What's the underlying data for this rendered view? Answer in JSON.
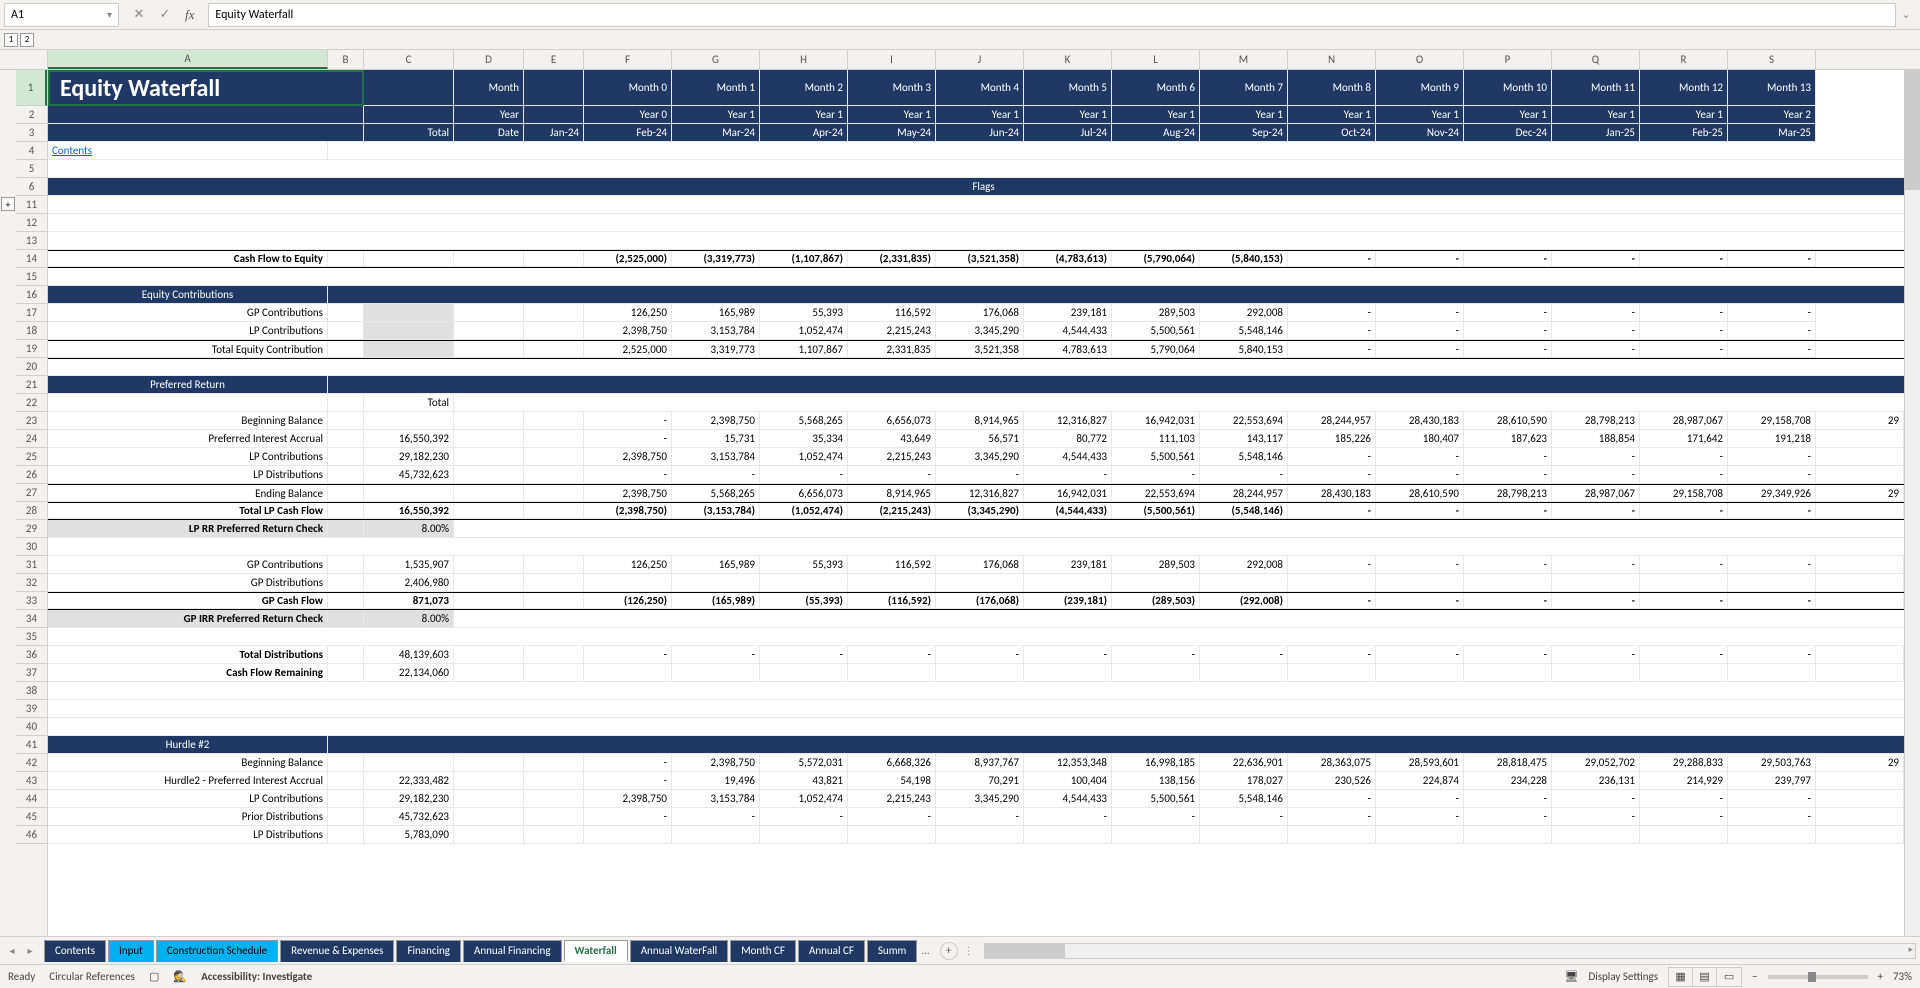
{
  "nameBox": "A1",
  "formula": "Equity Waterfall",
  "outline": [
    "1",
    "2"
  ],
  "columns": [
    "A",
    "B",
    "C",
    "D",
    "E",
    "F",
    "G",
    "H",
    "I",
    "J",
    "K",
    "L",
    "M",
    "N",
    "O",
    "P",
    "Q",
    "R",
    "S"
  ],
  "rowNumbers": [
    "1",
    "2",
    "3",
    "4",
    "5",
    "6",
    "11",
    "12",
    "13",
    "14",
    "15",
    "16",
    "17",
    "18",
    "19",
    "20",
    "21",
    "22",
    "23",
    "24",
    "25",
    "26",
    "27",
    "28",
    "29",
    "30",
    "31",
    "32",
    "33",
    "34",
    "35",
    "36",
    "37",
    "38",
    "39",
    "40",
    "41",
    "42",
    "43",
    "44",
    "45",
    "46"
  ],
  "title": "Equity Waterfall",
  "headerRows": {
    "month": [
      "Month",
      "",
      "Month 0",
      "Month 1",
      "Month 2",
      "Month 3",
      "Month 4",
      "Month 5",
      "Month 6",
      "Month 7",
      "Month 8",
      "Month 9",
      "Month 10",
      "Month 11",
      "Month 12",
      "Month 13"
    ],
    "year": [
      "Year",
      "",
      "Year 0",
      "Year 1",
      "Year 1",
      "Year 1",
      "Year 1",
      "Year 1",
      "Year 1",
      "Year 1",
      "Year 1",
      "Year 1",
      "Year 1",
      "Year 1",
      "Year 1",
      "Year 2"
    ],
    "date": [
      "Date",
      "Jan-24",
      "Feb-24",
      "Mar-24",
      "Apr-24",
      "May-24",
      "Jun-24",
      "Jul-24",
      "Aug-24",
      "Sep-24",
      "Oct-24",
      "Nov-24",
      "Dec-24",
      "Jan-25",
      "Feb-25",
      "Mar-25"
    ]
  },
  "labels": {
    "total": "Total",
    "contents": "Contents",
    "flags": "Flags",
    "cashFlowToEquity": "Cash Flow to Equity",
    "equityContributions": "Equity Contributions",
    "gpContributions": "GP Contributions",
    "lpContributions": "LP Contributions",
    "totalEquityContribution": "Total Equity Contribution",
    "preferredReturn": "Preferred Return",
    "beginningBalance": "Beginning Balance",
    "preferredInterestAccrual": "Preferred Interest Accrual",
    "lpDistributions": "LP Distributions",
    "endingBalance": "Ending Balance",
    "totalLpCashFlow": "Total LP Cash Flow",
    "lpRrCheck": "LP RR Preferred Return Check",
    "gpDistributions": "GP Distributions",
    "gpCashFlow": "GP Cash Flow",
    "gpIrrCheck": "GP IRR Preferred Return Check",
    "totalDistributions": "Total Distributions",
    "cashFlowRemaining": "Cash Flow Remaining",
    "hurdle2": "Hurdle #2",
    "hurdle2Accrual": "Hurdle2 - Preferred Interest Accrual",
    "priorDistributions": "Prior Distributions"
  },
  "rows": {
    "cashFlowToEquity": [
      "",
      "",
      "(2,525,000)",
      "(3,319,773)",
      "(1,107,867)",
      "(2,331,835)",
      "(3,521,358)",
      "(4,783,613)",
      "(5,790,064)",
      "(5,840,153)",
      "-",
      "-",
      "-",
      "-",
      "-",
      "-"
    ],
    "gpContributions": [
      "",
      "",
      "126,250",
      "165,989",
      "55,393",
      "116,592",
      "176,068",
      "239,181",
      "289,503",
      "292,008",
      "-",
      "-",
      "-",
      "-",
      "-",
      "-"
    ],
    "lpContributions": [
      "",
      "",
      "2,398,750",
      "3,153,784",
      "1,052,474",
      "2,215,243",
      "3,345,290",
      "4,544,433",
      "5,500,561",
      "5,548,146",
      "-",
      "-",
      "-",
      "-",
      "-",
      "-"
    ],
    "totalEquityContribution": [
      "",
      "",
      "2,525,000",
      "3,319,773",
      "1,107,867",
      "2,331,835",
      "3,521,358",
      "4,783,613",
      "5,790,064",
      "5,840,153",
      "-",
      "-",
      "-",
      "-",
      "-",
      "-"
    ],
    "prTotal": "Total",
    "beginningBalance": [
      "",
      "",
      "-",
      "2,398,750",
      "5,568,265",
      "6,656,073",
      "8,914,965",
      "12,316,827",
      "16,942,031",
      "22,553,694",
      "28,244,957",
      "28,430,183",
      "28,610,590",
      "28,798,213",
      "28,987,067",
      "29,158,708",
      "29"
    ],
    "preferredInterestAccrual": [
      "16,550,392",
      "",
      "-",
      "15,731",
      "35,334",
      "43,649",
      "56,571",
      "80,772",
      "111,103",
      "143,117",
      "185,226",
      "180,407",
      "187,623",
      "188,854",
      "171,642",
      "191,218",
      ""
    ],
    "lpContributions2": [
      "29,182,230",
      "",
      "2,398,750",
      "3,153,784",
      "1,052,474",
      "2,215,243",
      "3,345,290",
      "4,544,433",
      "5,500,561",
      "5,548,146",
      "-",
      "-",
      "-",
      "-",
      "-",
      "-",
      ""
    ],
    "lpDistributions": [
      "45,732,623",
      "",
      "-",
      "-",
      "-",
      "-",
      "-",
      "-",
      "-",
      "-",
      "-",
      "-",
      "-",
      "-",
      "-",
      "-",
      ""
    ],
    "endingBalance": [
      "",
      "",
      "2,398,750",
      "5,568,265",
      "6,656,073",
      "8,914,965",
      "12,316,827",
      "16,942,031",
      "22,553,694",
      "28,244,957",
      "28,430,183",
      "28,610,590",
      "28,798,213",
      "28,987,067",
      "29,158,708",
      "29,349,926",
      "29"
    ],
    "totalLpCashFlow": [
      "16,550,392",
      "",
      "(2,398,750)",
      "(3,153,784)",
      "(1,052,474)",
      "(2,215,243)",
      "(3,345,290)",
      "(4,544,433)",
      "(5,500,561)",
      "(5,548,146)",
      "-",
      "-",
      "-",
      "-",
      "-",
      "-",
      ""
    ],
    "lpRrCheck": "8.00%",
    "gpContributions2": [
      "1,535,907",
      "",
      "126,250",
      "165,989",
      "55,393",
      "116,592",
      "176,068",
      "239,181",
      "289,503",
      "292,008",
      "-",
      "-",
      "-",
      "-",
      "-",
      "-",
      ""
    ],
    "gpDistributions": [
      "2,406,980",
      "",
      "",
      "",
      "",
      "",
      "",
      "",
      "",
      "",
      "",
      "",
      "",
      "",
      "",
      "",
      ""
    ],
    "gpCashFlow": [
      "871,073",
      "",
      "(126,250)",
      "(165,989)",
      "(55,393)",
      "(116,592)",
      "(176,068)",
      "(239,181)",
      "(289,503)",
      "(292,008)",
      "-",
      "-",
      "-",
      "-",
      "-",
      "-",
      ""
    ],
    "gpIrrCheck": "8.00%",
    "totalDistributions": [
      "48,139,603",
      "",
      "-",
      "-",
      "-",
      "-",
      "-",
      "-",
      "-",
      "-",
      "-",
      "-",
      "-",
      "-",
      "-",
      "-",
      ""
    ],
    "cashFlowRemaining": [
      "22,134,060",
      "",
      "",
      "",
      "",
      "",
      "",
      "",
      "",
      "",
      "",
      "",
      "",
      "",
      "",
      "",
      ""
    ],
    "h2BeginningBalance": [
      "",
      "",
      "-",
      "2,398,750",
      "5,572,031",
      "6,668,326",
      "8,937,767",
      "12,353,348",
      "16,998,185",
      "22,636,901",
      "28,363,075",
      "28,593,601",
      "28,818,475",
      "29,052,702",
      "29,288,833",
      "29,503,763",
      "29"
    ],
    "h2Accrual": [
      "22,333,482",
      "",
      "-",
      "19,496",
      "43,821",
      "54,198",
      "70,291",
      "100,404",
      "138,156",
      "178,027",
      "230,526",
      "224,874",
      "234,228",
      "236,131",
      "214,929",
      "239,797",
      ""
    ],
    "h2LpContributions": [
      "29,182,230",
      "",
      "2,398,750",
      "3,153,784",
      "1,052,474",
      "2,215,243",
      "3,345,290",
      "4,544,433",
      "5,500,561",
      "5,548,146",
      "-",
      "-",
      "-",
      "-",
      "-",
      "-",
      ""
    ],
    "h2PriorDistributions": [
      "45,732,623",
      "",
      "-",
      "-",
      "-",
      "-",
      "-",
      "-",
      "-",
      "-",
      "-",
      "-",
      "-",
      "-",
      "-",
      "-",
      ""
    ],
    "h2LpDistributions": [
      "5,783,090",
      "",
      "",
      "",
      "",
      "",
      "",
      "",
      "",
      "",
      "",
      "",
      "",
      "",
      "",
      "",
      ""
    ]
  },
  "sheetTabs": [
    {
      "name": "Contents",
      "class": ""
    },
    {
      "name": "Input",
      "class": "cyan"
    },
    {
      "name": "Construction Schedule",
      "class": "cyan"
    },
    {
      "name": "Revenue & Expenses",
      "class": ""
    },
    {
      "name": "Financing",
      "class": ""
    },
    {
      "name": "Annual Financing",
      "class": ""
    },
    {
      "name": "Waterfall",
      "class": "active"
    },
    {
      "name": "Annual WaterFall",
      "class": ""
    },
    {
      "name": "Month CF",
      "class": ""
    },
    {
      "name": "Annual CF",
      "class": ""
    },
    {
      "name": "Summ",
      "class": ""
    }
  ],
  "tabMore": "...",
  "status": {
    "ready": "Ready",
    "circular": "Circular References",
    "accessibility": "Accessibility: Investigate",
    "displaySettings": "Display Settings",
    "zoom": "73%"
  }
}
